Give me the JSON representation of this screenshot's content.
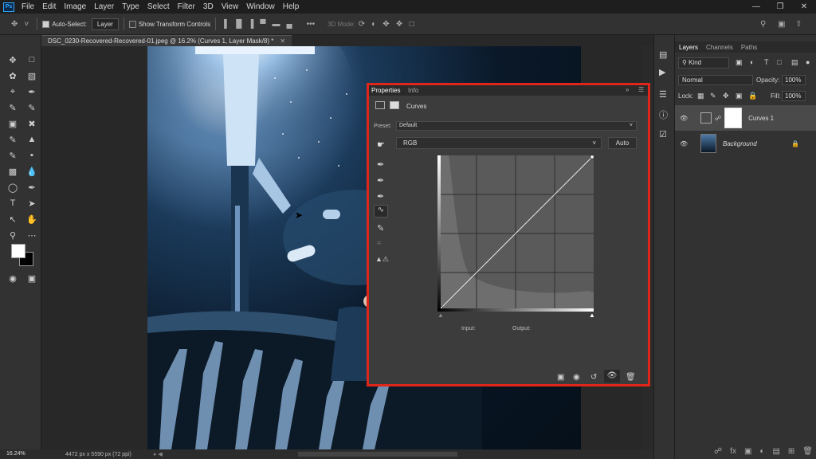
{
  "menu": {
    "items": [
      "File",
      "Edit",
      "Image",
      "Layer",
      "Type",
      "Select",
      "Filter",
      "3D",
      "View",
      "Window",
      "Help"
    ],
    "app_logo": "Ps"
  },
  "options_bar": {
    "auto_select_label": "Auto-Select:",
    "auto_select_target": "Layer",
    "transform_label": "Show Transform Controls",
    "mode_3d_label": "3D Mode:"
  },
  "document": {
    "tab_title": "DSC_0230-Recovered-Recovered-01.jpeg @ 16.2% (Curves 1, Layer Mask/8) *",
    "zoom": "16.24%",
    "dimensions": "4472 px x 5590 px (72 ppi)"
  },
  "properties": {
    "tabs": [
      "Properties",
      "Info"
    ],
    "adjustment_name": "Curves",
    "preset_label": "Preset:",
    "preset_value": "Default",
    "channel_value": "RGB",
    "auto_label": "Auto",
    "input_label": "Input:",
    "output_label": "Output:"
  },
  "layers_panel": {
    "tabs": [
      "Layers",
      "Channels",
      "Paths"
    ],
    "kind_label": "Kind",
    "blend_mode": "Normal",
    "opacity_label": "Opacity:",
    "opacity_value": "100%",
    "lock_label": "Lock:",
    "fill_label": "Fill:",
    "fill_value": "100%",
    "layers": [
      {
        "name": "Curves 1"
      },
      {
        "name": "Background"
      }
    ]
  },
  "colors": {
    "highlight_border": "#e0261b",
    "ps_blue": "#31a8ff"
  }
}
